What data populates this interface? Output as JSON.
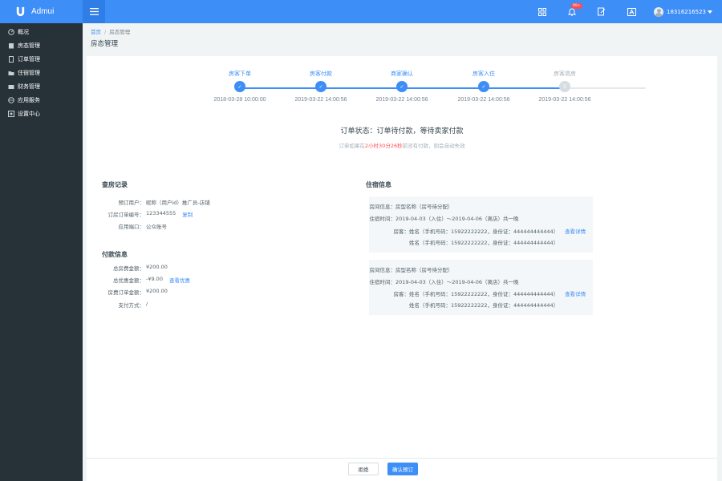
{
  "app": {
    "name": "Admui",
    "accent": "#3e8ef7",
    "sidebar_bg": "#263238"
  },
  "navbar": {
    "icons": [
      "grid-icon",
      "bell-icon",
      "edit-icon",
      "font-icon"
    ],
    "bell_badge": "99+",
    "user_name": "18316216523"
  },
  "sidebar": {
    "items": [
      {
        "label": "概况",
        "icon": "dashboard-icon"
      },
      {
        "label": "房态管理",
        "icon": "building-icon"
      },
      {
        "label": "订单管理",
        "icon": "document-icon"
      },
      {
        "label": "住宿管理",
        "icon": "folder-icon"
      },
      {
        "label": "财务管理",
        "icon": "finance-icon"
      },
      {
        "label": "应用服务",
        "icon": "globe-icon"
      },
      {
        "label": "设置中心",
        "icon": "settings-icon"
      }
    ]
  },
  "breadcrumb": {
    "home": "首页",
    "sep": "/",
    "current": "房态管理"
  },
  "page_title": "房态管理",
  "steps": [
    {
      "label": "房客下单",
      "time": "2018-03-28 10:00:00",
      "done": true,
      "mark": "✓"
    },
    {
      "label": "房客付款",
      "time": "2019-03-22 14:00:56",
      "done": true,
      "mark": "✓"
    },
    {
      "label": "商家确认",
      "time": "2019-03-22 14:00:56",
      "done": true,
      "mark": "✓"
    },
    {
      "label": "房客入住",
      "time": "2019-03-22 14:00:56",
      "done": true,
      "mark": "✓"
    },
    {
      "label": "房客退房",
      "time": "2019-03-22 14:00:56",
      "done": false,
      "mark": "5"
    }
  ],
  "status": {
    "title": "订单状态：订单待付款，等待卖家付款",
    "sub_prefix": "订单如果在",
    "sub_time": "2小时30分26秒",
    "sub_suffix": "前没有付款，则会自动失效"
  },
  "inspection": {
    "title": "查房记录",
    "rows": [
      {
        "key": "预订用户：",
        "value": "昵称（用户id）推广员-店铺"
      },
      {
        "key": "订房订单编号：",
        "value": "123344555",
        "action": "复制"
      },
      {
        "key": "应用端口：",
        "value": "公众账号"
      }
    ]
  },
  "payment": {
    "title": "付款信息",
    "rows": [
      {
        "key": "总房费金额：",
        "value": "¥200.00"
      },
      {
        "key": "总优惠金额：",
        "value": "-¥9.00",
        "action": "查看优惠"
      },
      {
        "key": "房费订单金额：",
        "value": "¥200.00"
      },
      {
        "key": "支付方式：",
        "value": "/"
      }
    ]
  },
  "lodging": {
    "title": "住宿信息",
    "cards": [
      {
        "room_key": "房间信息：",
        "room_value": "房型名称（房号待分配）",
        "stay_key": "住宿时间：",
        "stay_value": "2019-04-03（入住）～2019-04-06（离店）共一晚",
        "guest_key": "房客：",
        "guest1": "姓名（手机号码：15922222222，身份证：444444444444）",
        "guest2": "姓名（手机号码：15922222222，身份证：444444444444）",
        "detail": "查看详情"
      },
      {
        "room_key": "房间信息：",
        "room_value": "房型名称（房号待分配）",
        "stay_key": "住宿时间：",
        "stay_value": "2019-04-03（入住）～2019-04-06（离店）共一晚",
        "guest_key": "房客：",
        "guest1": "姓名（手机号码：15922222222，身份证：444444444444）",
        "guest2": "姓名（手机号码：15922222222，身份证：444444444444）",
        "detail": "查看详情"
      }
    ]
  },
  "actions": {
    "reject": "拒绝",
    "confirm": "确认预订"
  }
}
